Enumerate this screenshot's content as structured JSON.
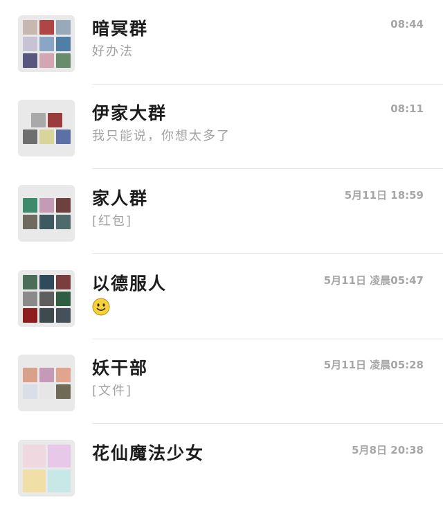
{
  "chats": [
    {
      "name": "暗冥群",
      "preview": "好办法",
      "time": "08:44",
      "avatar_tiles": [
        "#c6b7b0",
        "#b04545",
        "#98a9b9",
        "#c7c2d4",
        "#8aa6c4",
        "#4f7fa6",
        "#585680",
        "#d4a6b4",
        "#6a8c6e"
      ]
    },
    {
      "name": "伊家大群",
      "preview": "我只能说，你想太多了",
      "time": "08:11",
      "avatar_tiles": [
        "#a9a9a9",
        "#9b3c3c",
        "#6e6e6e",
        "#d8d59a",
        "#5e6fa6"
      ]
    },
    {
      "name": "家人群",
      "preview": "[红包]",
      "time": "5月11日 18:59",
      "avatar_tiles": [
        "#3f8a6a",
        "#c49ab5",
        "#6e4040",
        "#6e6a5e",
        "#3e5a60",
        "#4e6a6a"
      ]
    },
    {
      "name": "以德服人",
      "preview_emoji": "smiley",
      "time": "5月11日 凌晨05:47",
      "avatar_tiles": [
        "#4a6e58",
        "#2f4a5a",
        "#7a3e3e",
        "#8a8a8a",
        "#5e5e5e",
        "#2f5e42",
        "#8e1e1e",
        "#3e4a4e",
        "#46505a"
      ]
    },
    {
      "name": "妖干部",
      "preview": "[文件]",
      "time": "5月11日 凌晨05:28",
      "avatar_tiles": [
        "#d9a08a",
        "#c59ab8",
        "#e1a58e",
        "#d9dfe8",
        "#e6e6e6",
        "#6e6a56"
      ]
    },
    {
      "name": "花仙魔法少女",
      "preview": "",
      "time": "5月8日 20:38",
      "avatar_tiles": [
        "#f0d8e0",
        "#e8c8e8",
        "#f0e0a8",
        "#c8e8e8"
      ]
    }
  ]
}
